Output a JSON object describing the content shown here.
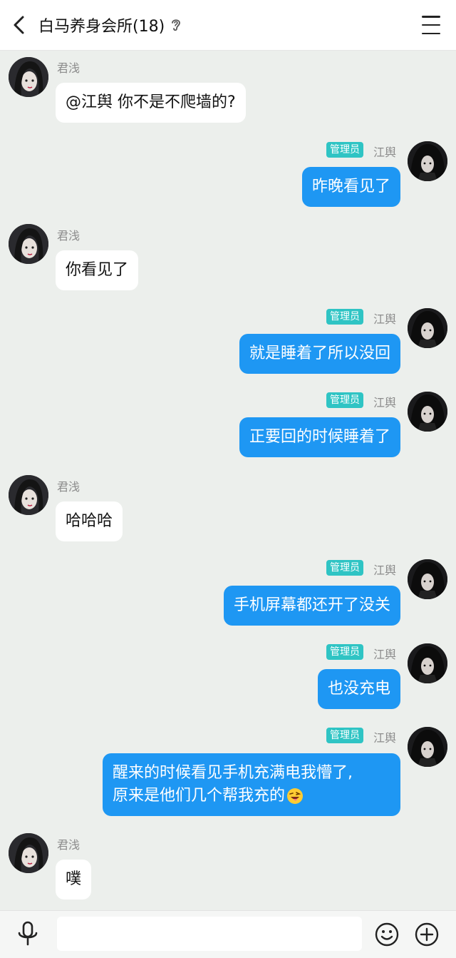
{
  "header": {
    "title": "白马养身会所(18)"
  },
  "messages": [
    {
      "side": "in",
      "sender": "君浅",
      "text": "@江舆 你不是不爬墙的?"
    },
    {
      "side": "out",
      "sender": "江舆",
      "badge": "管理员",
      "text": "昨晚看见了"
    },
    {
      "side": "in",
      "sender": "君浅",
      "text": "你看见了"
    },
    {
      "side": "out",
      "sender": "江舆",
      "badge": "管理员",
      "text": "就是睡着了所以没回"
    },
    {
      "side": "out",
      "sender": "江舆",
      "badge": "管理员",
      "text": "正要回的时候睡着了"
    },
    {
      "side": "in",
      "sender": "君浅",
      "text": "哈哈哈"
    },
    {
      "side": "out",
      "sender": "江舆",
      "badge": "管理员",
      "text": "手机屏幕都还开了没关"
    },
    {
      "side": "out",
      "sender": "江舆",
      "badge": "管理员",
      "text": "也没充电"
    },
    {
      "side": "out",
      "sender": "江舆",
      "badge": "管理员",
      "text": "醒来的时候看见手机充满电我懵了,",
      "text2": "原来是他们几个帮我充的",
      "emoji": "laughing-tongue-emoji"
    },
    {
      "side": "in",
      "sender": "君浅",
      "text": "噗"
    }
  ],
  "input": {
    "placeholder": ""
  },
  "colors": {
    "accent": "#1e97f3",
    "badge": "#2fc4c4",
    "background": "#ecefec"
  }
}
